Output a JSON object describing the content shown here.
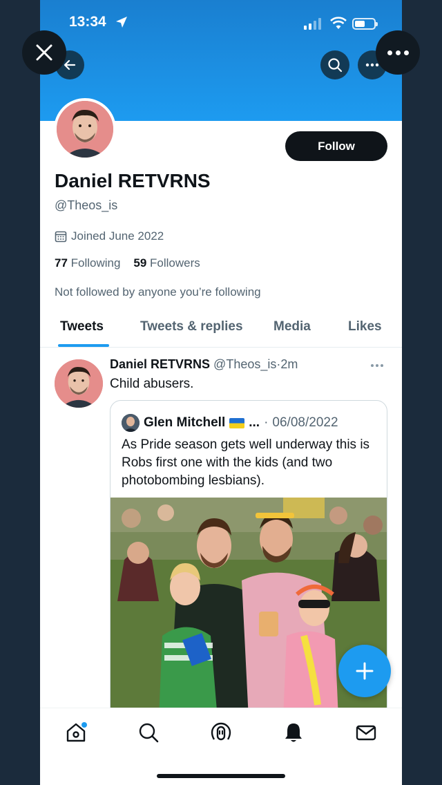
{
  "status_bar": {
    "time": "13:34"
  },
  "profile": {
    "display_name": "Daniel RETVRNS",
    "handle": "@Theos_is",
    "joined": "Joined June 2022",
    "following_count": "77",
    "following_label": "Following",
    "followers_count": "59",
    "followers_label": "Followers",
    "not_followed_note": "Not followed by anyone you’re following",
    "follow_button": "Follow"
  },
  "tabs": [
    {
      "label": "Tweets",
      "active": true
    },
    {
      "label": "Tweets & replies",
      "active": false
    },
    {
      "label": "Media",
      "active": false
    },
    {
      "label": "Likes",
      "active": false
    }
  ],
  "tweet": {
    "author_name": "Daniel RETVRNS",
    "author_handle": "@Theos_is",
    "separator": "·",
    "time": "2m",
    "text": "Child abusers.",
    "quoted": {
      "author_name": "Glen Mitchell",
      "ellipsis": "...",
      "separator": "·",
      "date": "06/08/2022",
      "text": "As Pride season gets well underway this is Robs first one with the kids (and two photobombing lesbians).",
      "image_description": "group photo"
    }
  },
  "colors": {
    "accent": "#1d9bf0",
    "banner": "#1d9bf0",
    "text": "#0f1419",
    "muted": "#536471"
  },
  "icons": [
    "close-icon",
    "more-icon",
    "back-arrow-icon",
    "search-icon",
    "home-icon",
    "explore-icon",
    "spaces-icon",
    "notifications-icon",
    "messages-icon",
    "compose-icon",
    "calendar-icon"
  ]
}
